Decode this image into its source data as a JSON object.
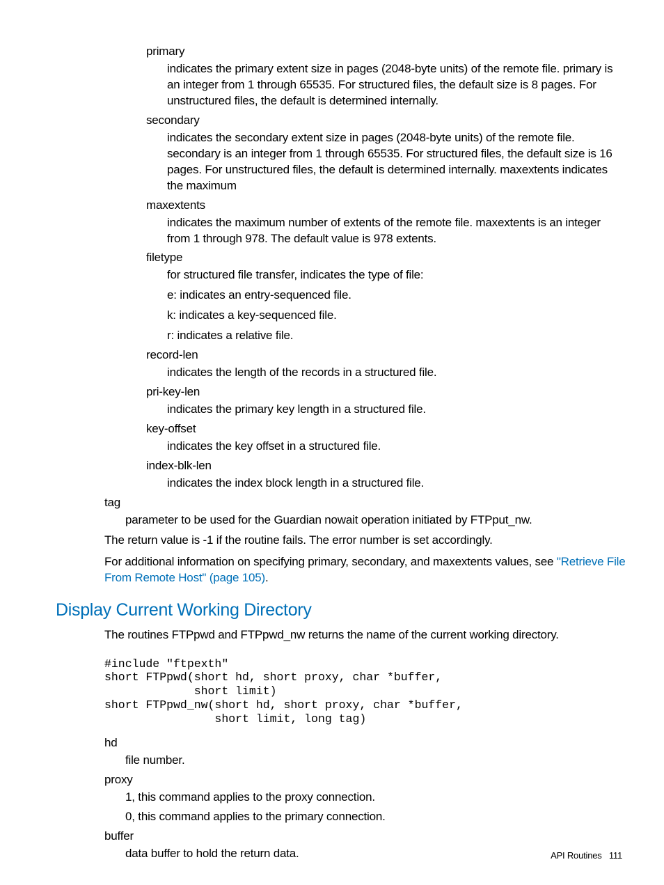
{
  "terms": {
    "primary": {
      "label": "primary",
      "desc": "indicates the primary extent size in pages (2048-byte units) of the remote file. primary is an integer from 1 through 65535. For structured files, the default size is 8 pages. For unstructured files, the default is determined internally."
    },
    "secondary": {
      "label": "secondary",
      "desc": "indicates the secondary extent size in pages (2048-byte units) of the remote file. secondary is an integer from 1 through 65535. For structured files, the default size is 16 pages. For unstructured files, the default is determined internally. maxextents indicates the maximum"
    },
    "maxextents": {
      "label": "maxextents",
      "desc": "indicates the maximum number of extents of the remote file. maxextents is an integer from 1 through 978. The default value is 978 extents."
    },
    "filetype": {
      "label": "filetype",
      "desc": "for structured file transfer, indicates the type of file:",
      "e": "e: indicates an entry-sequenced file.",
      "k": "k: indicates a key-sequenced file.",
      "r": "r: indicates a relative file."
    },
    "recordlen": {
      "label": "record-len",
      "desc": "indicates the length of the records in a structured file."
    },
    "prikeylen": {
      "label": "pri-key-len",
      "desc": "indicates the primary key length in a structured file."
    },
    "keyoffset": {
      "label": "key-offset",
      "desc": "indicates the key offset in a structured file."
    },
    "indexblklen": {
      "label": "index-blk-len",
      "desc": "indicates the index block length in a structured file."
    },
    "tag": {
      "label": "tag",
      "desc": "parameter to be used for the Guardian nowait operation initiated by FTPput_nw."
    }
  },
  "return": "The return value is -1 if the routine fails. The error number is set accordingly.",
  "addinfo_pre": "For additional information on specifying primary, secondary, and maxextents values, see ",
  "addinfo_link": "\"Retrieve File From Remote Host\" (page 105)",
  "addinfo_post": ".",
  "section": {
    "title": "Display Current Working Directory",
    "intro": "The routines FTPpwd and FTPpwd_nw returns the name of the current working directory.",
    "code": "#include \"ftpexth\"\nshort FTPpwd(short hd, short proxy, char *buffer,\n             short limit)\nshort FTPpwd_nw(short hd, short proxy, char *buffer,\n                short limit, long tag)",
    "hd": {
      "label": "hd",
      "desc": "file number."
    },
    "proxy": {
      "label": "proxy",
      "l1": "1, this command applies to the proxy connection.",
      "l0": "0, this command applies to the primary connection."
    },
    "buffer": {
      "label": "buffer",
      "desc": "data buffer to hold the return data."
    }
  },
  "footer": {
    "section": "API Routines",
    "page": "111"
  }
}
